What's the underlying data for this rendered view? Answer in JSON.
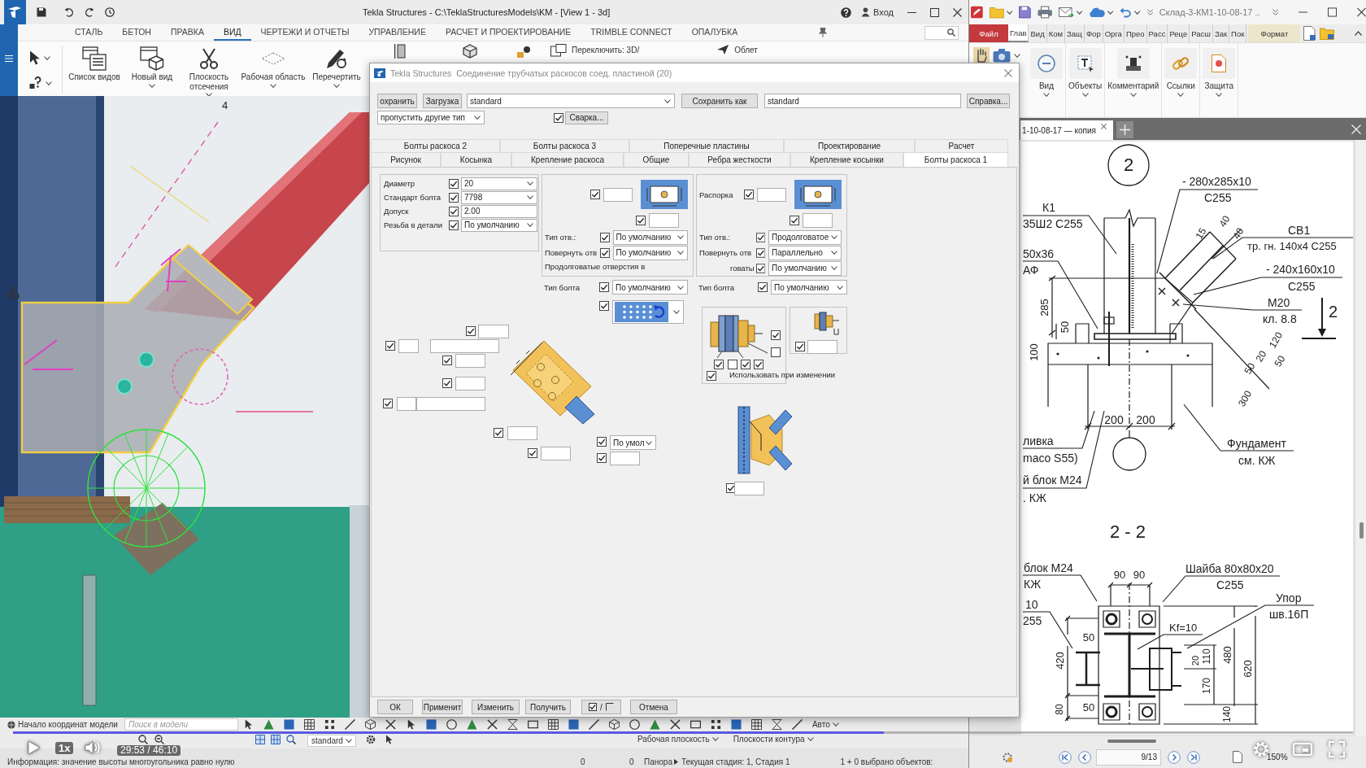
{
  "tekla": {
    "title": "Tekla Structures - C:\\TeklaStructuresModels\\KM - [View 1 - 3d]",
    "login": "Вход",
    "tabs": [
      {
        "label": "СТАЛЬ",
        "selected": false
      },
      {
        "label": "БЕТОН",
        "selected": false
      },
      {
        "label": "ПРАВКА",
        "selected": false
      },
      {
        "label": "ВИД",
        "selected": true
      },
      {
        "label": "ЧЕРТЕЖИ И ОТЧЕТЫ",
        "selected": false
      },
      {
        "label": "УПРАВЛЕНИЕ",
        "selected": false
      },
      {
        "label": "РАСЧЕТ И ПРОЕКТИРОВАНИЕ",
        "selected": false
      },
      {
        "label": "TRIMBLE CONNECT",
        "selected": false
      },
      {
        "label": "ОПАЛУБКА",
        "selected": false
      }
    ],
    "ribbon": [
      {
        "kind": "view-list",
        "label": "Список видов",
        "dropdown": false
      },
      {
        "kind": "new-view",
        "label": "Новый вид",
        "dropdown": true
      },
      {
        "kind": "clip-plane",
        "label": "Плоскость отсечения",
        "dropdown": true
      },
      {
        "kind": "work-area",
        "label": "Рабочая область",
        "dropdown": true
      },
      {
        "kind": "redraw",
        "label": "Перечертить",
        "dropdown": true
      }
    ],
    "ribbon_small": [
      "Переключить: 3D/",
      "Облет"
    ],
    "viewport": {
      "grid_label": "4"
    },
    "toolbar": {
      "origin": "Начало координат модели",
      "search_placeholder": "Поиск в модели",
      "snap_mode": "Авто",
      "view_filter": "standard",
      "work_plane": "Рабочая плоскость",
      "contour_planes": "Плоскости контура"
    },
    "status": {
      "message": "Информация: значение высоты многоугольника равно нулю",
      "counters": [
        "0",
        "0"
      ],
      "mode": "Панора",
      "phase": "Текущая стадия: 1, Стадия 1",
      "selection": "1 + 0 выбрано объектов:"
    }
  },
  "dialog": {
    "app": "Tekla Structures",
    "title": "Соединение трубчатых раскосов соед. пластиной (20)",
    "toolbar": {
      "save": "охранить",
      "load": "Загрузка",
      "preset": "standard",
      "save_as": "Сохранить как",
      "save_as_name": "standard",
      "help": "Справка..."
    },
    "filter": "пропустить другие тип",
    "weld": {
      "checked": true,
      "label": "Сварка..."
    },
    "tabs_back": [
      {
        "label": "Болты раскоса 2",
        "selected": false
      },
      {
        "label": "Болты раскоса 3",
        "selected": false
      },
      {
        "label": "Поперечные пластины",
        "selected": false
      },
      {
        "label": "Проектирование",
        "selected": false
      },
      {
        "label": "Расчет",
        "selected": false
      }
    ],
    "tabs_front": [
      {
        "label": "Рисунок",
        "selected": false
      },
      {
        "label": "Косынка",
        "selected": false
      },
      {
        "label": "Крепление раскоса",
        "selected": false
      },
      {
        "label": "Общие",
        "selected": false
      },
      {
        "label": "Ребра жесткости",
        "selected": false
      },
      {
        "label": "Крепление косынки",
        "selected": false
      },
      {
        "label": "Болты раскоса 1",
        "selected": true
      }
    ],
    "bolt_props": [
      {
        "label": "Диаметр",
        "checked": true,
        "kind": "dropdown",
        "value": "20"
      },
      {
        "label": "Стандарт болта",
        "checked": true,
        "kind": "dropdown",
        "value": "7798"
      },
      {
        "label": "Допуск",
        "checked": true,
        "kind": "text",
        "value": "2.00"
      },
      {
        "label": "Резьба в детали",
        "checked": true,
        "kind": "dropdown",
        "value": "По умолчанию"
      }
    ],
    "plate_holes": {
      "fields": [
        {
          "checked": true
        },
        {
          "checked": true
        }
      ],
      "rows": [
        {
          "label": "Тип отв.:",
          "checked": true,
          "value": "По умолчанию"
        },
        {
          "label": "Повернуть отв",
          "checked": true,
          "value": "По умолчанию"
        }
      ],
      "note": "Продолговатые отверстия в"
    },
    "spacer_holes": {
      "label": "Распорка",
      "fields": [
        {
          "checked": true
        },
        {
          "checked": true
        }
      ],
      "rows": [
        {
          "label": "Тип отв.:",
          "checked": true,
          "value": "Продолговатое"
        },
        {
          "label": "Повернуть отв",
          "checked": true,
          "value": "Параллельно"
        },
        {
          "label": "говаты",
          "checked": true,
          "value": "По умолчанию"
        }
      ]
    },
    "bolt_type": [
      {
        "label": "Тип болта",
        "checked": true,
        "value": "По умолчанию"
      },
      {
        "label": "Тип болта",
        "checked": true,
        "value": "По умолчанию"
      }
    ],
    "pattern": {
      "checked": true
    },
    "layout_fields": [
      {
        "kind": "field",
        "checked": true
      },
      {
        "kind": "split",
        "checked": true
      },
      {
        "kind": "field",
        "checked": true
      },
      {
        "kind": "field",
        "checked": true
      },
      {
        "kind": "split",
        "checked": true
      },
      {
        "kind": "field",
        "checked": true
      },
      {
        "kind": "field",
        "checked": true
      },
      {
        "kind": "dropdown",
        "checked": true,
        "value": "По умол"
      },
      {
        "kind": "field",
        "checked": true
      }
    ],
    "assembly": {
      "options": [
        {
          "checked": true
        },
        {
          "checked": false
        },
        {
          "checked": true
        },
        {
          "checked": false
        },
        {
          "checked": true
        },
        {
          "checked": true
        }
      ],
      "use_on_modify": {
        "checked": true,
        "label": "Использовать при изменении"
      }
    },
    "washer": {
      "checked": true
    },
    "elevation": {
      "checked": true
    },
    "buttons": [
      {
        "kind": "text",
        "label": "ОК"
      },
      {
        "kind": "text",
        "label": "Применит"
      },
      {
        "kind": "text",
        "label": "Изменить"
      },
      {
        "kind": "text",
        "label": "Получить"
      },
      {
        "kind": "toggle",
        "label": "/"
      },
      {
        "kind": "text",
        "label": "Отмена"
      }
    ]
  },
  "pdf_viewer": {
    "title": "Склад-3-КМ1-10-08-17 ..",
    "tabs": [
      {
        "kind": "file",
        "label": "Файл",
        "selected": false
      },
      {
        "kind": "tab",
        "label": "Глав",
        "selected": true
      },
      {
        "kind": "tab",
        "label": "Вид",
        "selected": false
      },
      {
        "kind": "tab",
        "label": "Ком",
        "selected": false
      },
      {
        "kind": "tab",
        "label": "Защ",
        "selected": false
      },
      {
        "kind": "tab",
        "label": "Фор",
        "selected": false
      },
      {
        "kind": "tab",
        "label": "Орга",
        "selected": false
      },
      {
        "kind": "tab",
        "label": "Прео",
        "selected": false
      },
      {
        "kind": "tab",
        "label": "Расс",
        "selected": false
      },
      {
        "kind": "tab",
        "label": "Реце",
        "selected": false
      },
      {
        "kind": "tab",
        "label": "Расш",
        "selected": false
      },
      {
        "kind": "tab",
        "label": "Зак",
        "selected": false
      },
      {
        "kind": "tab",
        "label": "Пок",
        "selected": false
      },
      {
        "kind": "context",
        "label": "Формат",
        "selected": false
      }
    ],
    "ribbon": [
      {
        "kind": "view",
        "label": "Вид"
      },
      {
        "kind": "objects",
        "label": "Объекты"
      },
      {
        "kind": "comment",
        "label": "Комментарий"
      },
      {
        "kind": "links",
        "label": "Ссылки"
      },
      {
        "kind": "protect",
        "label": "Защита"
      }
    ],
    "document_tab": "1-10-08-17 — копия",
    "drawing": {
      "labels": [
        "2",
        "- 280x285x10",
        "С255",
        "К1",
        "35Ш2 С255",
        "СВ1",
        "тр. гн. 140х4 С255",
        "50x36",
        "АФ",
        "- 240x160x10",
        "С255",
        "М20",
        "кл. 8.8",
        "2",
        "285",
        "50",
        "100",
        "15",
        "40",
        "40",
        "120",
        "20",
        "50",
        "50",
        "300",
        "200",
        "200",
        "ливка",
        "maco S55)",
        "й блок М24",
        ". КЖ",
        "Фундамент",
        "см. КЖ",
        "2 - 2",
        "блок М24",
        "КЖ",
        "10",
        "255",
        "90",
        "90",
        "Шайба 80x80x20",
        "С255",
        "Упор",
        "шв.16П",
        "Kf=10",
        "50",
        "420",
        "110",
        "20",
        "480",
        "620",
        "170",
        "50",
        "80",
        "140"
      ]
    },
    "page": "9/13",
    "zoom": "150%"
  },
  "video": {
    "speed": "1x",
    "time": "29:53 / 46:10",
    "progress": {
      "level": 0.65
    }
  }
}
